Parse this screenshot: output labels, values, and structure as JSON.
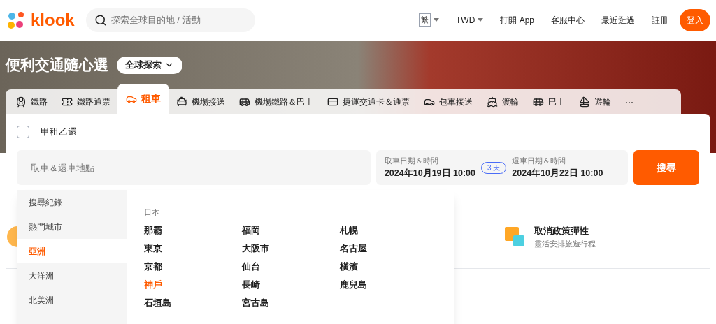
{
  "header": {
    "logo": "klook",
    "search": {
      "placeholder": "探索全球目的地 / 活動"
    },
    "language": "繁",
    "currency": "TWD",
    "links": [
      "打開 App",
      "客服中心",
      "最近逛過",
      "註冊"
    ],
    "login": "登入"
  },
  "hero": {
    "title": "便利交通隨心選",
    "explore": "全球探索"
  },
  "tabs": [
    {
      "label": "鐵路",
      "selected": false
    },
    {
      "label": "鐵路通票",
      "selected": false
    },
    {
      "label": "租車",
      "selected": true
    },
    {
      "label": "機場接送",
      "selected": false
    },
    {
      "label": "機場鐵路＆巴士",
      "selected": false
    },
    {
      "label": "捷運交通卡＆通票",
      "selected": false
    },
    {
      "label": "包車接送",
      "selected": false
    },
    {
      "label": "渡輪",
      "selected": false
    },
    {
      "label": "巴士",
      "selected": false
    },
    {
      "label": "遊輪",
      "selected": false
    },
    {
      "label": "···",
      "selected": false
    }
  ],
  "form": {
    "different_return": {
      "label": "甲租乙還",
      "checked": false
    },
    "location": {
      "placeholder": "取車＆還車地點"
    },
    "pickup": {
      "label": "取車日期＆時間",
      "value": "2024年10月19日 10:00"
    },
    "duration": "3 天",
    "return": {
      "label": "還車日期＆時間",
      "value": "2024年10月22日 10:00"
    },
    "search_button": "搜尋"
  },
  "dropdown": {
    "regions": [
      {
        "label": "搜尋紀錄",
        "selected": false
      },
      {
        "label": "熱門城市",
        "selected": false
      },
      {
        "label": "亞洲",
        "selected": true
      },
      {
        "label": "大洋洲",
        "selected": false
      },
      {
        "label": "北美洲",
        "selected": false
      }
    ],
    "country": "日本",
    "cities": [
      {
        "label": "那霸",
        "selected": false
      },
      {
        "label": "福岡",
        "selected": false
      },
      {
        "label": "札幌",
        "selected": false
      },
      {
        "label": "東京",
        "selected": false
      },
      {
        "label": "大阪市",
        "selected": false
      },
      {
        "label": "名古屋",
        "selected": false
      },
      {
        "label": "京都",
        "selected": false
      },
      {
        "label": "仙台",
        "selected": false
      },
      {
        "label": "橫濱",
        "selected": false
      },
      {
        "label": "神戶",
        "selected": true
      },
      {
        "label": "長崎",
        "selected": false
      },
      {
        "label": "鹿兒島",
        "selected": false
      },
      {
        "label": "石垣島",
        "selected": false
      },
      {
        "label": "宮古島",
        "selected": false
      }
    ]
  },
  "feature": {
    "title": "取消政策彈性",
    "subtitle": "靈活安排旅遊行程"
  }
}
